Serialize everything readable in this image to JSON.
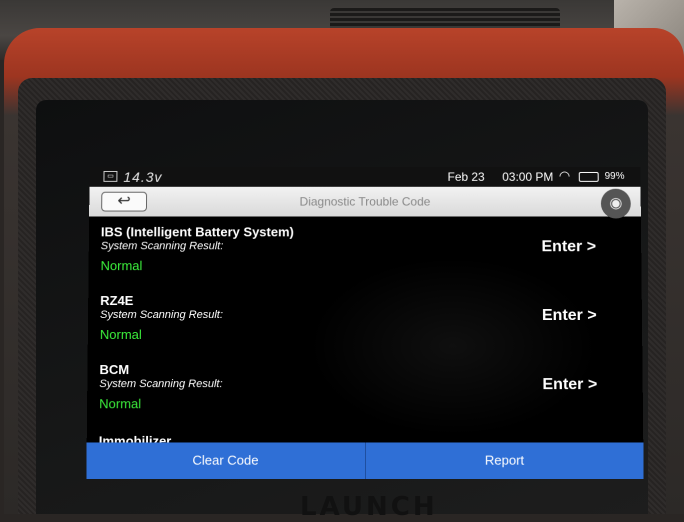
{
  "status_bar": {
    "voltage": "14.3v",
    "date": "Feb 23",
    "time": "03:00 PM",
    "battery": "99%"
  },
  "header": {
    "title": "Diagnostic Trouble Code",
    "back_icon": "back-arrow-icon",
    "camera_icon": "camera-icon"
  },
  "systems": [
    {
      "name": "IBS (Intelligent Battery System)",
      "subtitle": "System Scanning Result:",
      "status": "Normal",
      "action": "Enter >"
    },
    {
      "name": "RZ4E",
      "subtitle": "System Scanning Result:",
      "status": "Normal",
      "action": "Enter >"
    },
    {
      "name": "BCM",
      "subtitle": "System Scanning Result:",
      "status": "Normal",
      "action": "Enter >"
    }
  ],
  "partial_row": "Immobilizer",
  "footer": {
    "clear_code": "Clear Code",
    "report": "Report"
  },
  "device_brand": "LAUNCH",
  "colors": {
    "status_normal": "#3cf03c",
    "action_bar": "#2f6fd6"
  }
}
